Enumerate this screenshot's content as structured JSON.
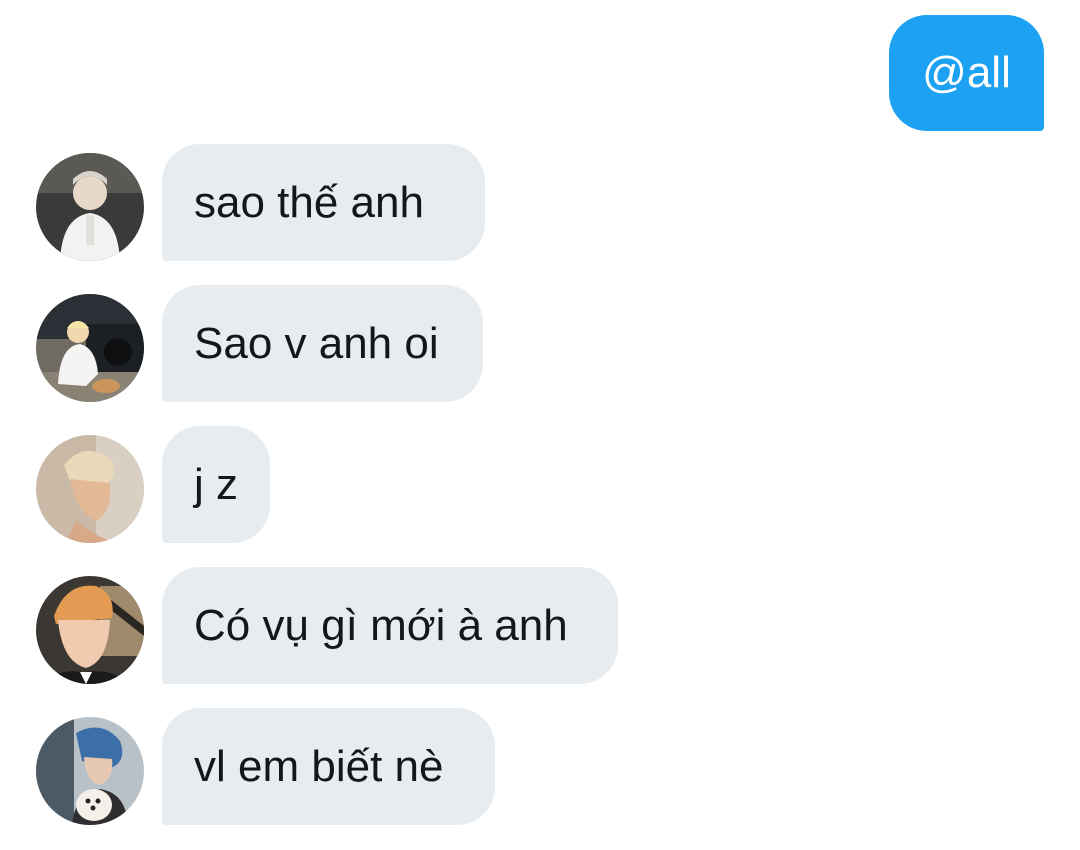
{
  "outgoing": {
    "text": "@all",
    "color": "#1da1f2"
  },
  "incoming_bubble_color": "#e6ecf0",
  "messages": [
    {
      "text": "sao thế anh",
      "avatar": "user-photo-1"
    },
    {
      "text": "Sao v anh oi",
      "avatar": "user-photo-2"
    },
    {
      "text": "j z",
      "avatar": "user-photo-3"
    },
    {
      "text": "Có vụ gì mới à anh",
      "avatar": "user-photo-4"
    },
    {
      "text": "vl em biết nè",
      "avatar": "user-photo-5"
    }
  ]
}
